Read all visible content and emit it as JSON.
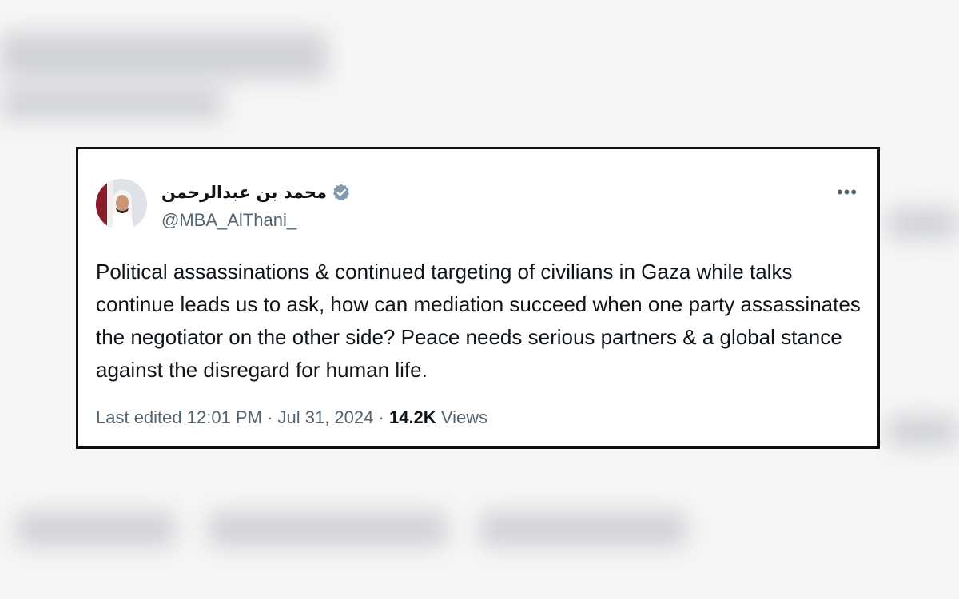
{
  "tweet": {
    "display_name": "محمد بن عبدالرحمن",
    "verified_icon": "verified-badge-icon",
    "handle": "@MBA_AlThani_",
    "more_icon": "more-options-icon",
    "more_label": "•••",
    "text": "Political assassinations & continued targeting of civilians in Gaza while talks continue leads us to ask, how can mediation succeed when one party assassinates the negotiator on the other side? Peace needs serious partners & a global stance against the disregard for human life.",
    "meta": {
      "edited_label": "Last edited",
      "time": "12:01 PM",
      "separator": "·",
      "date": "Jul 31, 2024",
      "views_count": "14.2K",
      "views_label": "Views"
    }
  },
  "colors": {
    "primary_text": "#0f1419",
    "secondary_text": "#536471",
    "verified_badge": "#829aab",
    "card_border": "#111111"
  }
}
